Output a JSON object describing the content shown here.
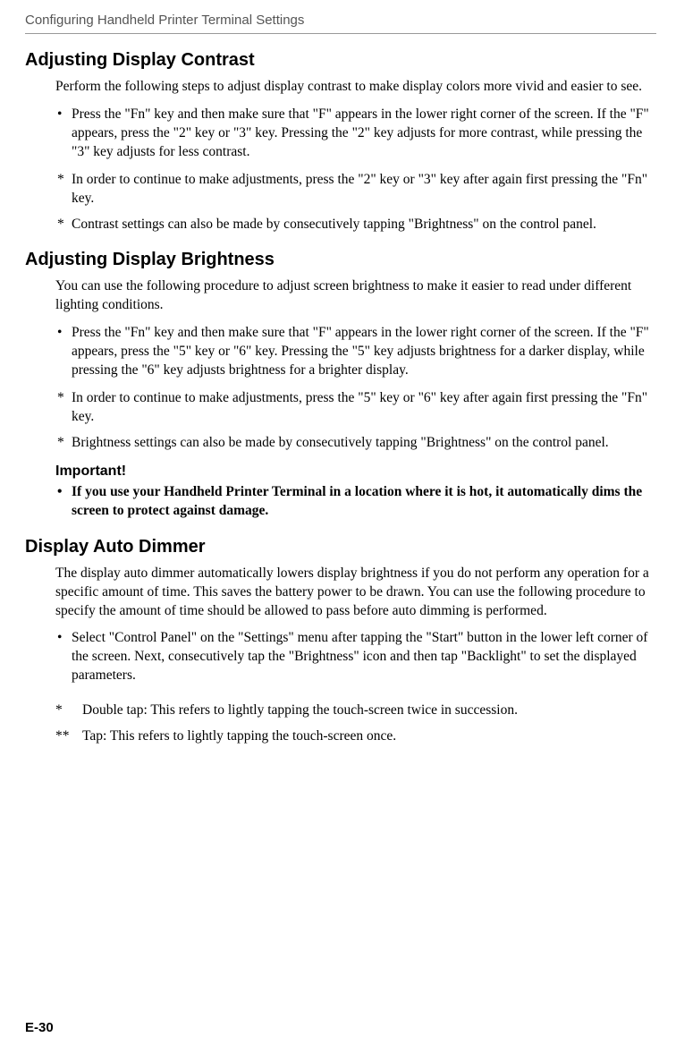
{
  "runningHead": "Configuring Handheld Printer Terminal Settings",
  "sections": {
    "contrast": {
      "title": "Adjusting Display Contrast",
      "intro": "Perform the following steps to adjust display contrast to make display colors more vivid and easier to see.",
      "bullet1": "Press the \"Fn\" key and then make sure that \"F\" appears in the lower right corner of the screen. If the \"F\" appears, press the \"2\" key or \"3\" key.  Pressing the \"2\" key adjusts for more contrast, while pressing the \"3\" key adjusts for less contrast.",
      "note1": "In order to continue to make adjustments, press the \"2\" key or \"3\" key after again first pressing the \"Fn\" key.",
      "note2": "Contrast settings can also be made by consecutively tapping \"Brightness\" on the control panel."
    },
    "brightness": {
      "title": "Adjusting Display Brightness",
      "intro": "You can use the following procedure to adjust screen brightness to make it easier to read under different lighting conditions.",
      "bullet1": "Press the \"Fn\" key and then make sure that \"F\" appears in the lower right corner of the screen. If the \"F\" appears, press the \"5\" key or \"6\" key.  Pressing the \"5\" key adjusts brightness for a darker display, while pressing the \"6\" key adjusts brightness for a brighter display.",
      "note1": "In order to continue to make adjustments, press the \"5\" key or \"6\" key after again first pressing the \"Fn\" key.",
      "note2": "Brightness settings can also be made by consecutively tapping \"Brightness\" on the control panel.",
      "importantHead": "Important!",
      "importantBody": "If you use your Handheld Printer Terminal in a location where it is hot, it automatically dims the screen to protect against damage."
    },
    "dimmer": {
      "title": "Display Auto Dimmer",
      "intro": "The display auto dimmer automatically lowers display brightness if you do not perform any operation for a specific amount of time. This saves the battery power to be drawn. You can use the following procedure to specify the amount of time should be allowed to pass before auto dimming is performed.",
      "bullet1": "Select \"Control Panel\" on the \"Settings\" menu after tapping the \"Start\" button in the lower left corner of the screen.  Next, consecutively tap the \"Brightness\" icon and then tap \"Backlight\" to set the displayed parameters.",
      "footnote1marker": "*",
      "footnote1": "Double tap: This refers to lightly tapping the touch-screen twice in succession.",
      "footnote2marker": "**",
      "footnote2": "Tap: This refers to lightly tapping the touch-screen once."
    }
  },
  "pageNumber": "E-30"
}
